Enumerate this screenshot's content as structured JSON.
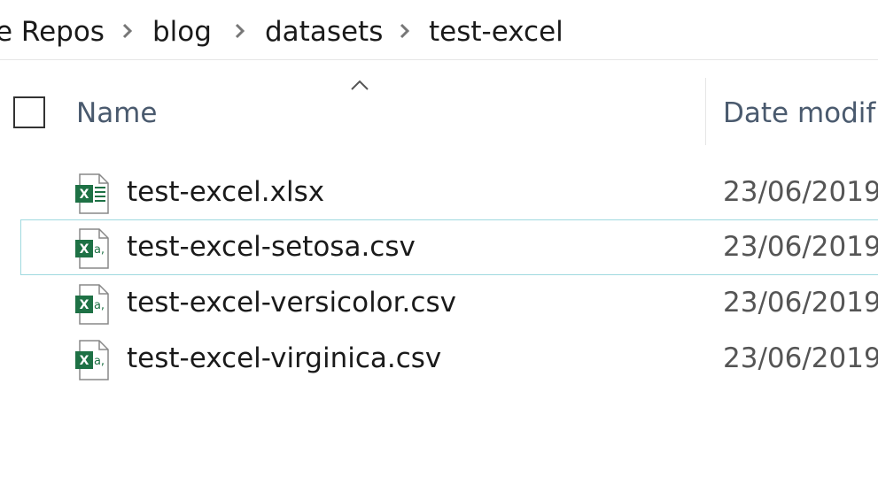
{
  "breadcrumb": {
    "items": [
      "e Repos",
      "blog",
      "datasets",
      "test-excel"
    ]
  },
  "columns": {
    "name": "Name",
    "date_modified": "Date modif"
  },
  "files": [
    {
      "name": "test-excel.xlsx",
      "date": "23/06/2019",
      "icon": "excel-xlsx-icon"
    },
    {
      "name": "test-excel-setosa.csv",
      "date": "23/06/2019",
      "icon": "excel-csv-icon"
    },
    {
      "name": "test-excel-versicolor.csv",
      "date": "23/06/2019",
      "icon": "excel-csv-icon"
    },
    {
      "name": "test-excel-virginica.csv",
      "date": "23/06/2019",
      "icon": "excel-csv-icon"
    }
  ],
  "colors": {
    "excel_green": "#1e7145",
    "hover_border": "#9fd9df",
    "header_text": "#4a5a6e"
  }
}
